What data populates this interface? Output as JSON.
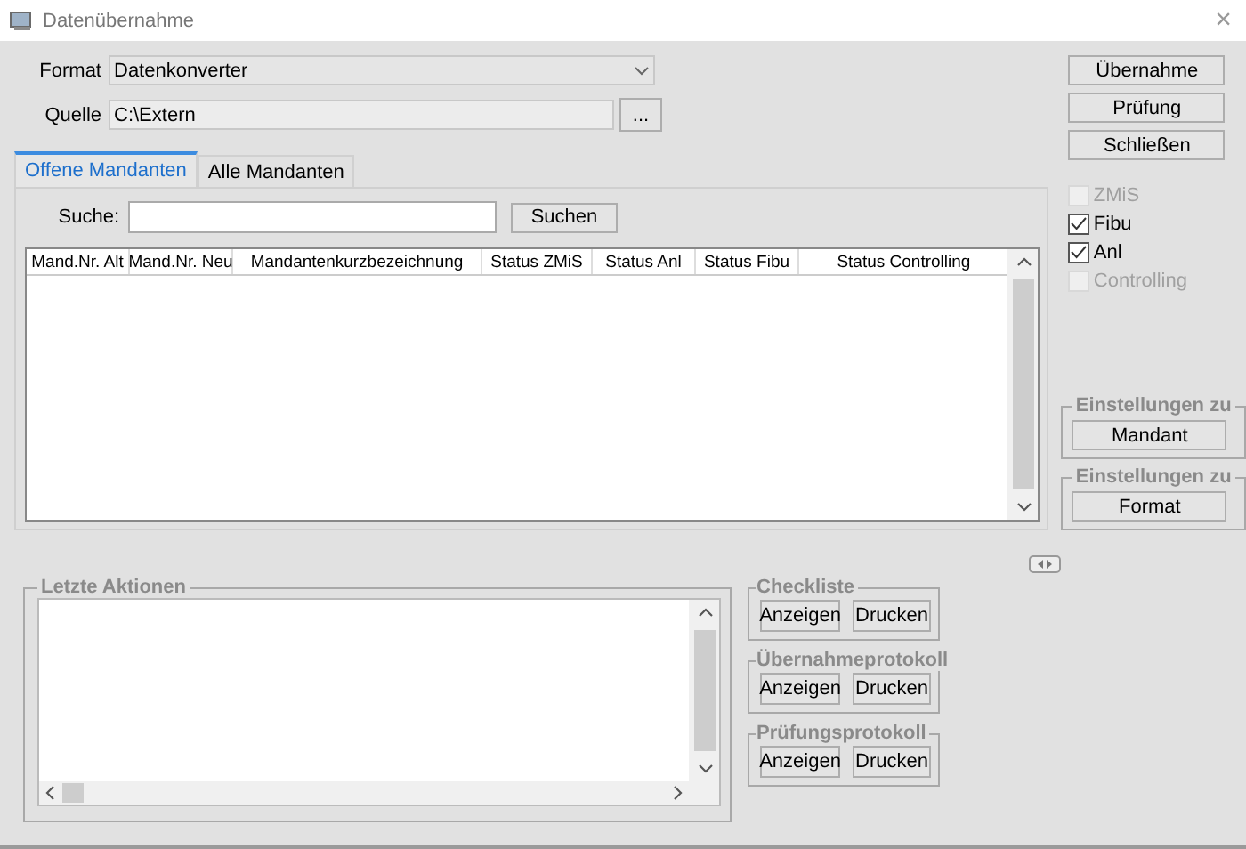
{
  "window": {
    "title": "Datenübernahme",
    "close": "×"
  },
  "format": {
    "label": "Format",
    "value": "Datenkonverter"
  },
  "source": {
    "label": "Quelle",
    "value": "C:\\Extern",
    "browse": "..."
  },
  "tabs": [
    {
      "label": "Offene Mandanten",
      "selected": true
    },
    {
      "label": "Alle Mandanten",
      "selected": false
    }
  ],
  "search": {
    "label": "Suche:",
    "button": "Suchen"
  },
  "table": {
    "columns": [
      "Mand.Nr. Alt",
      "Mand.Nr. Neu",
      "Mandantenkurzbezeichnung",
      "Status ZMiS",
      "Status Anl",
      "Status Fibu",
      "Status Controlling"
    ]
  },
  "actions": [
    "Übernahme",
    "Prüfung",
    "Schließen"
  ],
  "modules": [
    {
      "label": "ZMiS",
      "checked": false,
      "disabled": true
    },
    {
      "label": "Fibu",
      "checked": true,
      "disabled": false
    },
    {
      "label": "Anl",
      "checked": true,
      "disabled": false
    },
    {
      "label": "Controlling",
      "checked": false,
      "disabled": true
    }
  ],
  "settings": [
    {
      "title": "Einstellungen zu",
      "button": "Mandant"
    },
    {
      "title": "Einstellungen zu",
      "button": "Format"
    }
  ],
  "recent_actions": {
    "title": "Letzte Aktionen"
  },
  "reports": [
    {
      "title": "Checkliste",
      "buttons": [
        "Anzeigen",
        "Drucken"
      ]
    },
    {
      "title": "Übernahmeprotokoll",
      "buttons": [
        "Anzeigen",
        "Drucken"
      ]
    },
    {
      "title": "Prüfungsprotokoll",
      "buttons": [
        "Anzeigen",
        "Drucken"
      ]
    }
  ]
}
